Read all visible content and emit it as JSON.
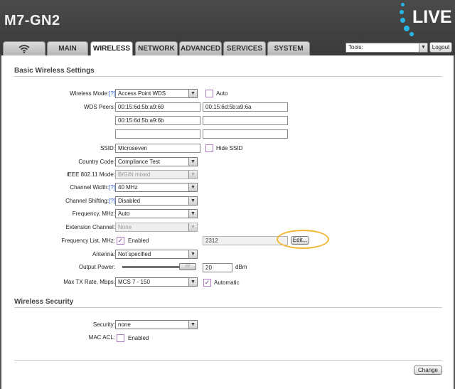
{
  "header": {
    "model": "M7-GN2",
    "logo_text": "LIVE"
  },
  "tabs": [
    {
      "label": "",
      "icon": "wifi-icon"
    },
    {
      "label": "MAIN"
    },
    {
      "label": "WIRELESS"
    },
    {
      "label": "NETWORK"
    },
    {
      "label": "ADVANCED"
    },
    {
      "label": "SERVICES"
    },
    {
      "label": "SYSTEM"
    }
  ],
  "tools": {
    "value": "Tools:",
    "logout_label": "Logout"
  },
  "basic": {
    "title": "Basic Wireless Settings",
    "wireless_mode": {
      "label": "Wireless Mode:",
      "help": "[?]",
      "value": "Access Point WDS",
      "auto_label": "Auto"
    },
    "wds_peers": {
      "label": "WDS Peers:",
      "values": [
        "00:15:6d:5b:a9:69",
        "00:15:6d:5b:a9:6a",
        "00:15:6d:5b:a9:6b",
        "",
        "",
        ""
      ]
    },
    "ssid": {
      "label": "SSID:",
      "value": "Microseven",
      "hide_label": "Hide SSID"
    },
    "country_code": {
      "label": "Country Code:",
      "value": "Compliance Test"
    },
    "ieee_mode": {
      "label": "IEEE 802.11 Mode:",
      "value": "B/G/N mixed"
    },
    "channel_width": {
      "label": "Channel Width:",
      "help": "[?]",
      "value": "40 MHz"
    },
    "channel_shifting": {
      "label": "Channel Shifting:",
      "help": "[?]",
      "value": "Disabled"
    },
    "frequency": {
      "label": "Frequency, MHz:",
      "value": "Auto"
    },
    "extension_channel": {
      "label": "Extension Channel:",
      "value": "None"
    },
    "frequency_list": {
      "label": "Frequency List, MHz:",
      "enabled_label": "Enabled",
      "value": "2312",
      "edit_label": "Edit..."
    },
    "antenna": {
      "label": "Antenna:",
      "value": "Not specified"
    },
    "output_power": {
      "label": "Output Power:",
      "value": "20",
      "unit": "dBm",
      "slider_thumb": "////"
    },
    "max_tx_rate": {
      "label": "Max TX Rate, Mbps:",
      "value": "MCS 7 - 150",
      "automatic_label": "Automatic"
    }
  },
  "security": {
    "title": "Wireless Security",
    "security": {
      "label": "Security:",
      "value": "none"
    },
    "mac_acl": {
      "label": "MAC ACL:",
      "enabled_label": "Enabled"
    }
  },
  "footer": {
    "change_label": "Change"
  },
  "colors": {
    "header_bg": "#3f3f3f",
    "accent": "#29b7e8",
    "highlight": "#f2b632",
    "checkbox": "#b07cc6"
  }
}
